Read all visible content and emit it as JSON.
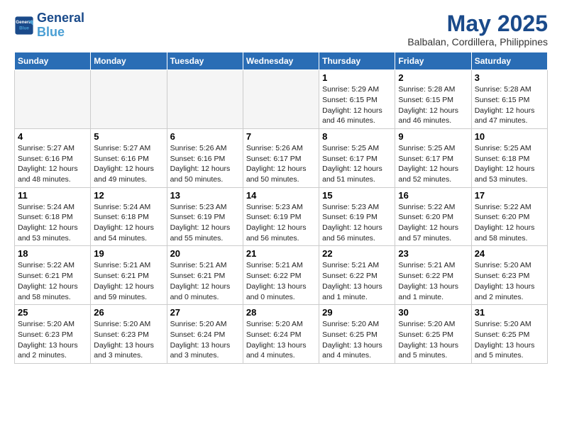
{
  "logo": {
    "line1": "General",
    "line2": "Blue"
  },
  "title": "May 2025",
  "subtitle": "Balbalan, Cordillera, Philippines",
  "weekdays": [
    "Sunday",
    "Monday",
    "Tuesday",
    "Wednesday",
    "Thursday",
    "Friday",
    "Saturday"
  ],
  "weeks": [
    [
      {
        "day": "",
        "info": ""
      },
      {
        "day": "",
        "info": ""
      },
      {
        "day": "",
        "info": ""
      },
      {
        "day": "",
        "info": ""
      },
      {
        "day": "1",
        "info": "Sunrise: 5:29 AM\nSunset: 6:15 PM\nDaylight: 12 hours\nand 46 minutes."
      },
      {
        "day": "2",
        "info": "Sunrise: 5:28 AM\nSunset: 6:15 PM\nDaylight: 12 hours\nand 46 minutes."
      },
      {
        "day": "3",
        "info": "Sunrise: 5:28 AM\nSunset: 6:15 PM\nDaylight: 12 hours\nand 47 minutes."
      }
    ],
    [
      {
        "day": "4",
        "info": "Sunrise: 5:27 AM\nSunset: 6:16 PM\nDaylight: 12 hours\nand 48 minutes."
      },
      {
        "day": "5",
        "info": "Sunrise: 5:27 AM\nSunset: 6:16 PM\nDaylight: 12 hours\nand 49 minutes."
      },
      {
        "day": "6",
        "info": "Sunrise: 5:26 AM\nSunset: 6:16 PM\nDaylight: 12 hours\nand 50 minutes."
      },
      {
        "day": "7",
        "info": "Sunrise: 5:26 AM\nSunset: 6:17 PM\nDaylight: 12 hours\nand 50 minutes."
      },
      {
        "day": "8",
        "info": "Sunrise: 5:25 AM\nSunset: 6:17 PM\nDaylight: 12 hours\nand 51 minutes."
      },
      {
        "day": "9",
        "info": "Sunrise: 5:25 AM\nSunset: 6:17 PM\nDaylight: 12 hours\nand 52 minutes."
      },
      {
        "day": "10",
        "info": "Sunrise: 5:25 AM\nSunset: 6:18 PM\nDaylight: 12 hours\nand 53 minutes."
      }
    ],
    [
      {
        "day": "11",
        "info": "Sunrise: 5:24 AM\nSunset: 6:18 PM\nDaylight: 12 hours\nand 53 minutes."
      },
      {
        "day": "12",
        "info": "Sunrise: 5:24 AM\nSunset: 6:18 PM\nDaylight: 12 hours\nand 54 minutes."
      },
      {
        "day": "13",
        "info": "Sunrise: 5:23 AM\nSunset: 6:19 PM\nDaylight: 12 hours\nand 55 minutes."
      },
      {
        "day": "14",
        "info": "Sunrise: 5:23 AM\nSunset: 6:19 PM\nDaylight: 12 hours\nand 56 minutes."
      },
      {
        "day": "15",
        "info": "Sunrise: 5:23 AM\nSunset: 6:19 PM\nDaylight: 12 hours\nand 56 minutes."
      },
      {
        "day": "16",
        "info": "Sunrise: 5:22 AM\nSunset: 6:20 PM\nDaylight: 12 hours\nand 57 minutes."
      },
      {
        "day": "17",
        "info": "Sunrise: 5:22 AM\nSunset: 6:20 PM\nDaylight: 12 hours\nand 58 minutes."
      }
    ],
    [
      {
        "day": "18",
        "info": "Sunrise: 5:22 AM\nSunset: 6:21 PM\nDaylight: 12 hours\nand 58 minutes."
      },
      {
        "day": "19",
        "info": "Sunrise: 5:21 AM\nSunset: 6:21 PM\nDaylight: 12 hours\nand 59 minutes."
      },
      {
        "day": "20",
        "info": "Sunrise: 5:21 AM\nSunset: 6:21 PM\nDaylight: 12 hours\nand 0 minutes."
      },
      {
        "day": "21",
        "info": "Sunrise: 5:21 AM\nSunset: 6:22 PM\nDaylight: 13 hours\nand 0 minutes."
      },
      {
        "day": "22",
        "info": "Sunrise: 5:21 AM\nSunset: 6:22 PM\nDaylight: 13 hours\nand 1 minute."
      },
      {
        "day": "23",
        "info": "Sunrise: 5:21 AM\nSunset: 6:22 PM\nDaylight: 13 hours\nand 1 minute."
      },
      {
        "day": "24",
        "info": "Sunrise: 5:20 AM\nSunset: 6:23 PM\nDaylight: 13 hours\nand 2 minutes."
      }
    ],
    [
      {
        "day": "25",
        "info": "Sunrise: 5:20 AM\nSunset: 6:23 PM\nDaylight: 13 hours\nand 2 minutes."
      },
      {
        "day": "26",
        "info": "Sunrise: 5:20 AM\nSunset: 6:23 PM\nDaylight: 13 hours\nand 3 minutes."
      },
      {
        "day": "27",
        "info": "Sunrise: 5:20 AM\nSunset: 6:24 PM\nDaylight: 13 hours\nand 3 minutes."
      },
      {
        "day": "28",
        "info": "Sunrise: 5:20 AM\nSunset: 6:24 PM\nDaylight: 13 hours\nand 4 minutes."
      },
      {
        "day": "29",
        "info": "Sunrise: 5:20 AM\nSunset: 6:25 PM\nDaylight: 13 hours\nand 4 minutes."
      },
      {
        "day": "30",
        "info": "Sunrise: 5:20 AM\nSunset: 6:25 PM\nDaylight: 13 hours\nand 5 minutes."
      },
      {
        "day": "31",
        "info": "Sunrise: 5:20 AM\nSunset: 6:25 PM\nDaylight: 13 hours\nand 5 minutes."
      }
    ]
  ]
}
